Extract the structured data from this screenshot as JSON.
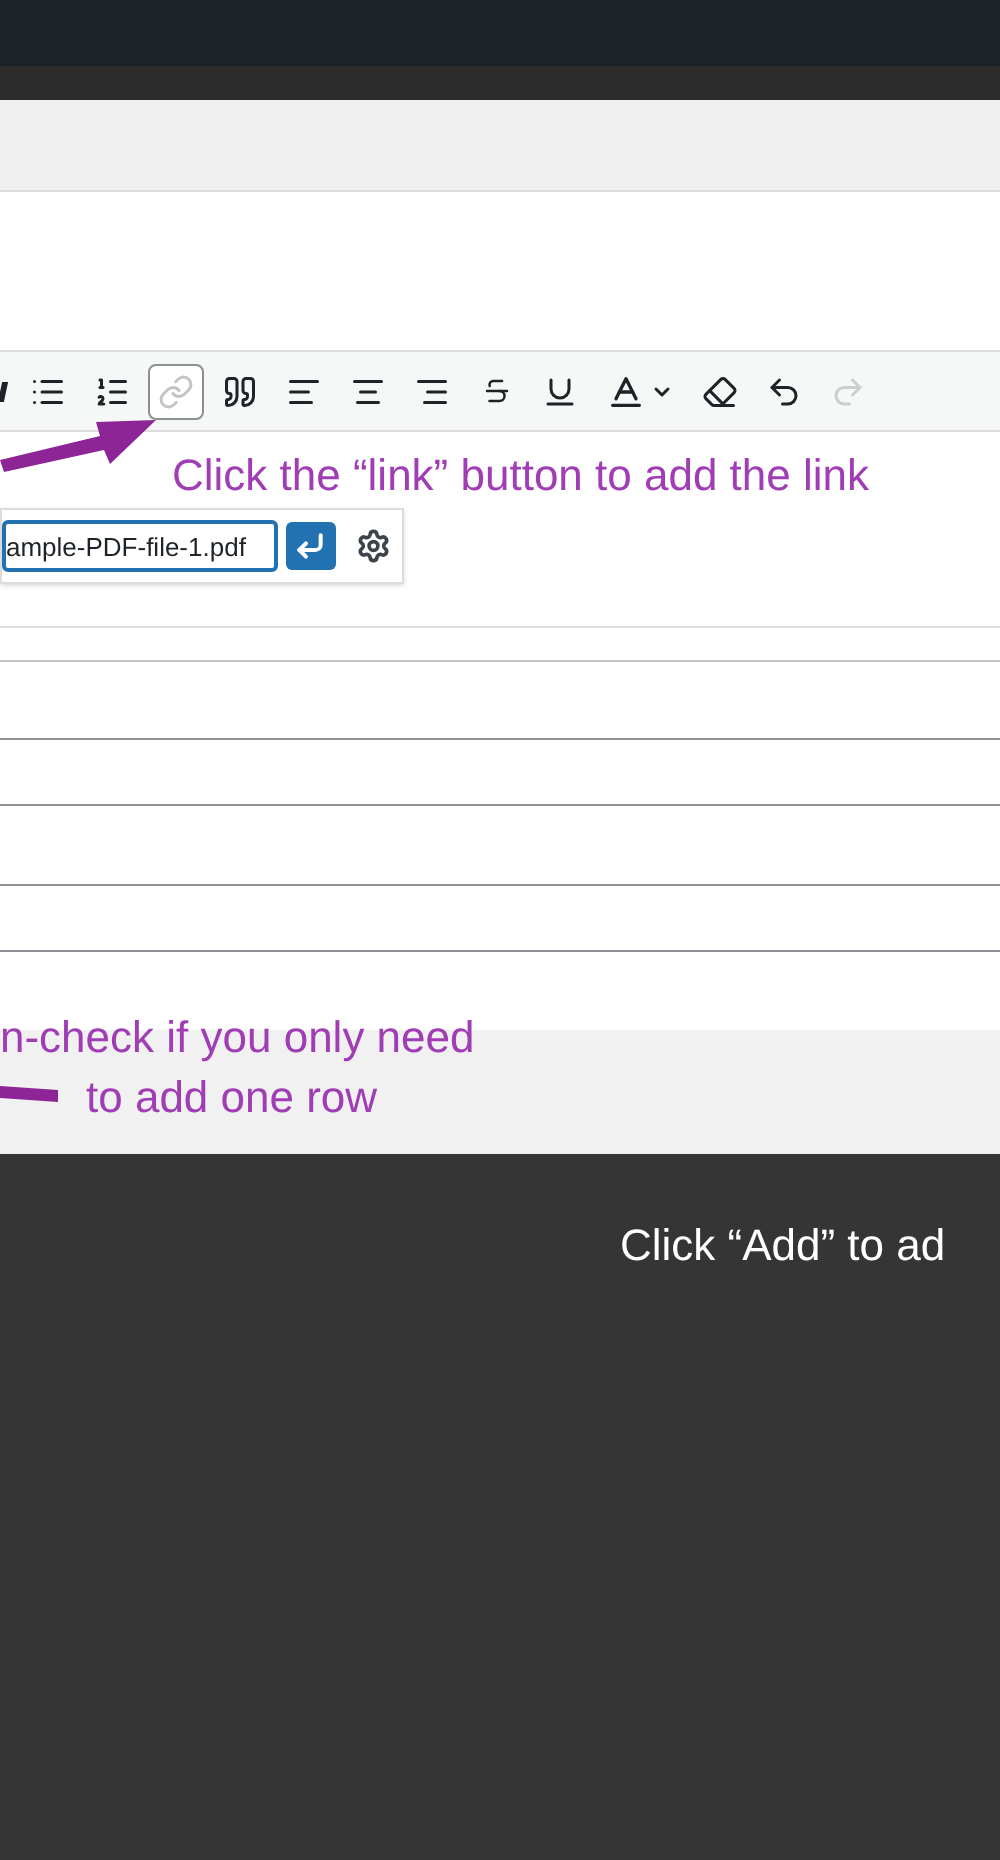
{
  "toolbar": {
    "buttons": [
      {
        "kind": "partial"
      },
      {
        "kind": "bullet-list",
        "selected": false,
        "disabled": false
      },
      {
        "kind": "numbered-list",
        "selected": false,
        "disabled": false
      },
      {
        "kind": "link",
        "selected": true,
        "disabled": false
      },
      {
        "kind": "quote",
        "selected": false,
        "disabled": false
      },
      {
        "kind": "align-left",
        "selected": false,
        "disabled": false
      },
      {
        "kind": "align-center",
        "selected": false,
        "disabled": false
      },
      {
        "kind": "align-right",
        "selected": false,
        "disabled": false
      },
      {
        "kind": "strikethrough",
        "selected": false,
        "disabled": false
      },
      {
        "kind": "underline",
        "selected": false,
        "disabled": false
      },
      {
        "kind": "text-color",
        "selected": false,
        "disabled": false
      },
      {
        "kind": "eraser",
        "selected": false,
        "disabled": false
      },
      {
        "kind": "undo",
        "selected": false,
        "disabled": false
      },
      {
        "kind": "redo",
        "selected": false,
        "disabled": true
      }
    ]
  },
  "link_popup": {
    "value": "ample-PDF-file-1.pdf"
  },
  "annotations": [
    {
      "text": "Click the “link” button to add the link"
    },
    {
      "text": "n-check if you only need"
    },
    {
      "text": "to add one row"
    }
  ],
  "footer_hint": "Click “Add” to ad"
}
